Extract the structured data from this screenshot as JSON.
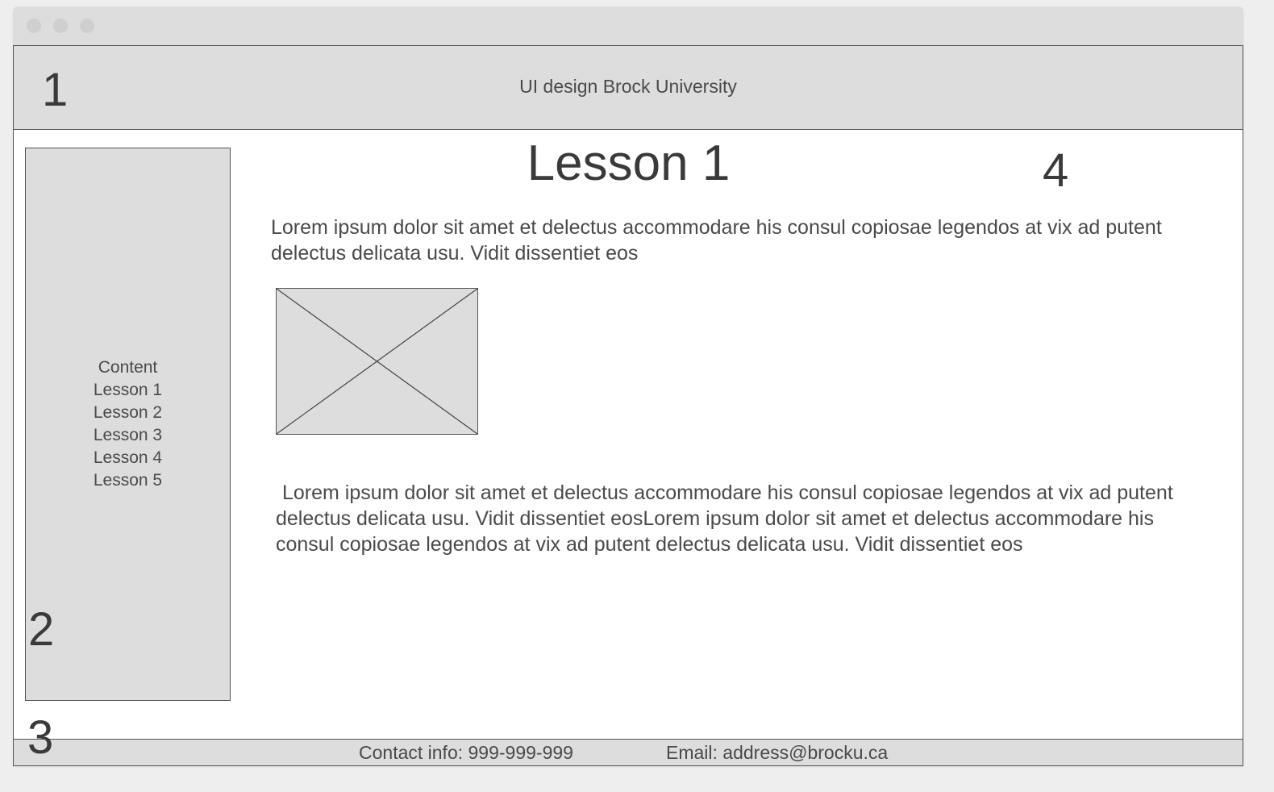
{
  "window": {
    "controls": [
      "close-dot",
      "minimize-dot",
      "maximize-dot"
    ]
  },
  "annotations": {
    "header_marker": "1",
    "sidebar_marker": "2",
    "footer_marker": "3",
    "content_marker": "4"
  },
  "header": {
    "title": "UI design Brock University"
  },
  "sidebar": {
    "heading": "Content",
    "items": [
      {
        "label": "Lesson 1"
      },
      {
        "label": "Lesson 2"
      },
      {
        "label": "Lesson 3"
      },
      {
        "label": "Lesson 4"
      },
      {
        "label": "Lesson 5"
      }
    ]
  },
  "main": {
    "heading": "Lesson 1",
    "paragraph1": "Lorem ipsum dolor sit amet et delectus accommodare his consul copiosae legendos at vix ad putent delectus delicata usu. Vidit dissentiet eos",
    "image_placeholder_icon": "image-placeholder-icon",
    "paragraph2": "Lorem ipsum dolor sit amet et delectus accommodare his consul copiosae legendos at vix ad putent delectus delicata usu. Vidit dissentiet eosLorem ipsum dolor sit amet et delectus accommodare his consul copiosae legendos at vix ad putent delectus delicata usu. Vidit dissentiet eos"
  },
  "footer": {
    "contact": "Contact info: 999-999-999",
    "email": "Email: address@brocku.ca"
  },
  "colors": {
    "panel_gray": "#dddddd",
    "border": "#555555",
    "text": "#4a4a4a"
  }
}
